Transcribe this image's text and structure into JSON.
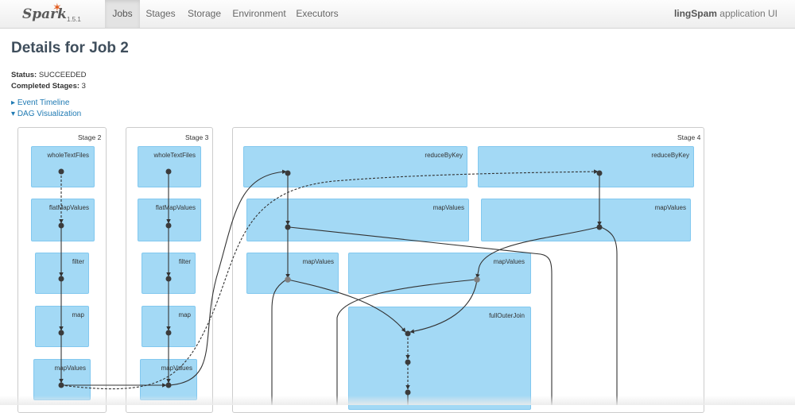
{
  "navbar": {
    "brand": "Spark",
    "version": "1.5.1",
    "tabs": [
      {
        "label": "Jobs",
        "active": true
      },
      {
        "label": "Stages",
        "active": false
      },
      {
        "label": "Storage",
        "active": false
      },
      {
        "label": "Environment",
        "active": false
      },
      {
        "label": "Executors",
        "active": false
      }
    ],
    "app_name": "lingSpam",
    "app_suffix": " application UI"
  },
  "page": {
    "title": "Details for Job 2",
    "status_label": "Status:",
    "status_value": " SUCCEEDED",
    "completed_label": "Completed Stages:",
    "completed_value": " 3",
    "event_timeline": "Event Timeline",
    "dag_visualization": "DAG Visualization",
    "event_timeline_arrow": "▸",
    "dag_arrow": "▾"
  },
  "dag": {
    "stages": [
      {
        "label": "Stage 2",
        "rdds": [
          "wholeTextFiles",
          "flatMapValues",
          "filter",
          "map",
          "mapValues"
        ]
      },
      {
        "label": "Stage 3",
        "rdds": [
          "wholeTextFiles",
          "flatMapValues",
          "filter",
          "map",
          "mapValues"
        ]
      },
      {
        "label": "Stage 4",
        "rdds": [
          "reduceByKey",
          "reduceByKey",
          "mapValues",
          "mapValues",
          "mapValues",
          "mapValues",
          "fullOuterJoin"
        ]
      }
    ],
    "colors": {
      "rdd_fill": "#a3d9f5",
      "rdd_border": "#82c8ef",
      "edge": "#333333",
      "node": "#3b3b3b",
      "shuffle_node": "#808080"
    }
  }
}
